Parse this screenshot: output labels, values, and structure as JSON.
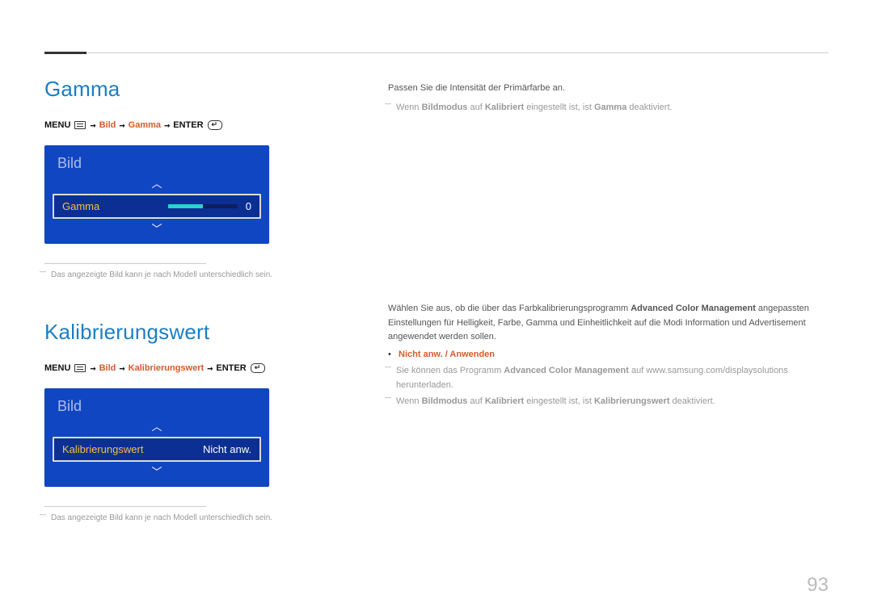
{
  "page_number": "93",
  "section1": {
    "heading": "Gamma",
    "menu_path": {
      "menu_label": "MENU",
      "arrow": "→",
      "p1": "Bild",
      "p2": "Gamma",
      "enter_label": "ENTER"
    },
    "panel": {
      "title": "Bild",
      "item_label": "Gamma",
      "item_value": "0",
      "arrow_up": "︿",
      "arrow_down": "﹀"
    },
    "footnote": "Das angezeigte Bild kann je nach Modell unterschiedlich sein.",
    "right": {
      "line1": "Passen Sie die Intensität der Primärfarbe an.",
      "note_pre": "Wenn ",
      "note_b1": "Bildmodus",
      "note_mid": " auf ",
      "note_b2": "Kalibriert",
      "note_post1": " eingestellt ist, ist ",
      "note_b3": "Gamma",
      "note_post2": " deaktiviert."
    }
  },
  "section2": {
    "heading": "Kalibrierungswert",
    "menu_path": {
      "menu_label": "MENU",
      "arrow": "→",
      "p1": "Bild",
      "p2": "Kalibrierungswert",
      "enter_label": "ENTER"
    },
    "panel": {
      "title": "Bild",
      "item_label": "Kalibrierungswert",
      "item_value": "Nicht anw.",
      "arrow_up": "︿",
      "arrow_down": "﹀"
    },
    "footnote": "Das angezeigte Bild kann je nach Modell unterschiedlich sein.",
    "right": {
      "line1_pre": "Wählen Sie aus, ob die über das Farbkalibrierungsprogramm ",
      "line1_b": "Advanced Color Management",
      "line1_post": " angepassten Einstellungen für Helligkeit, Farbe, Gamma und Einheitlichkeit auf die Modi Information und Advertisement angewendet werden sollen.",
      "bullet_dot": "•",
      "bullet_opt1": "Nicht anw.",
      "bullet_sep": " / ",
      "bullet_opt2": "Anwenden",
      "note1_pre": "Sie können das Programm ",
      "note1_b": "Advanced Color Management",
      "note1_post": " auf www.samsung.com/displaysolutions herunterladen.",
      "note2_pre": "Wenn ",
      "note2_b1": "Bildmodus",
      "note2_mid": " auf ",
      "note2_b2": "Kalibriert",
      "note2_post1": " eingestellt ist, ist ",
      "note2_b3": "Kalibrierungswert",
      "note2_post2": " deaktiviert."
    }
  }
}
